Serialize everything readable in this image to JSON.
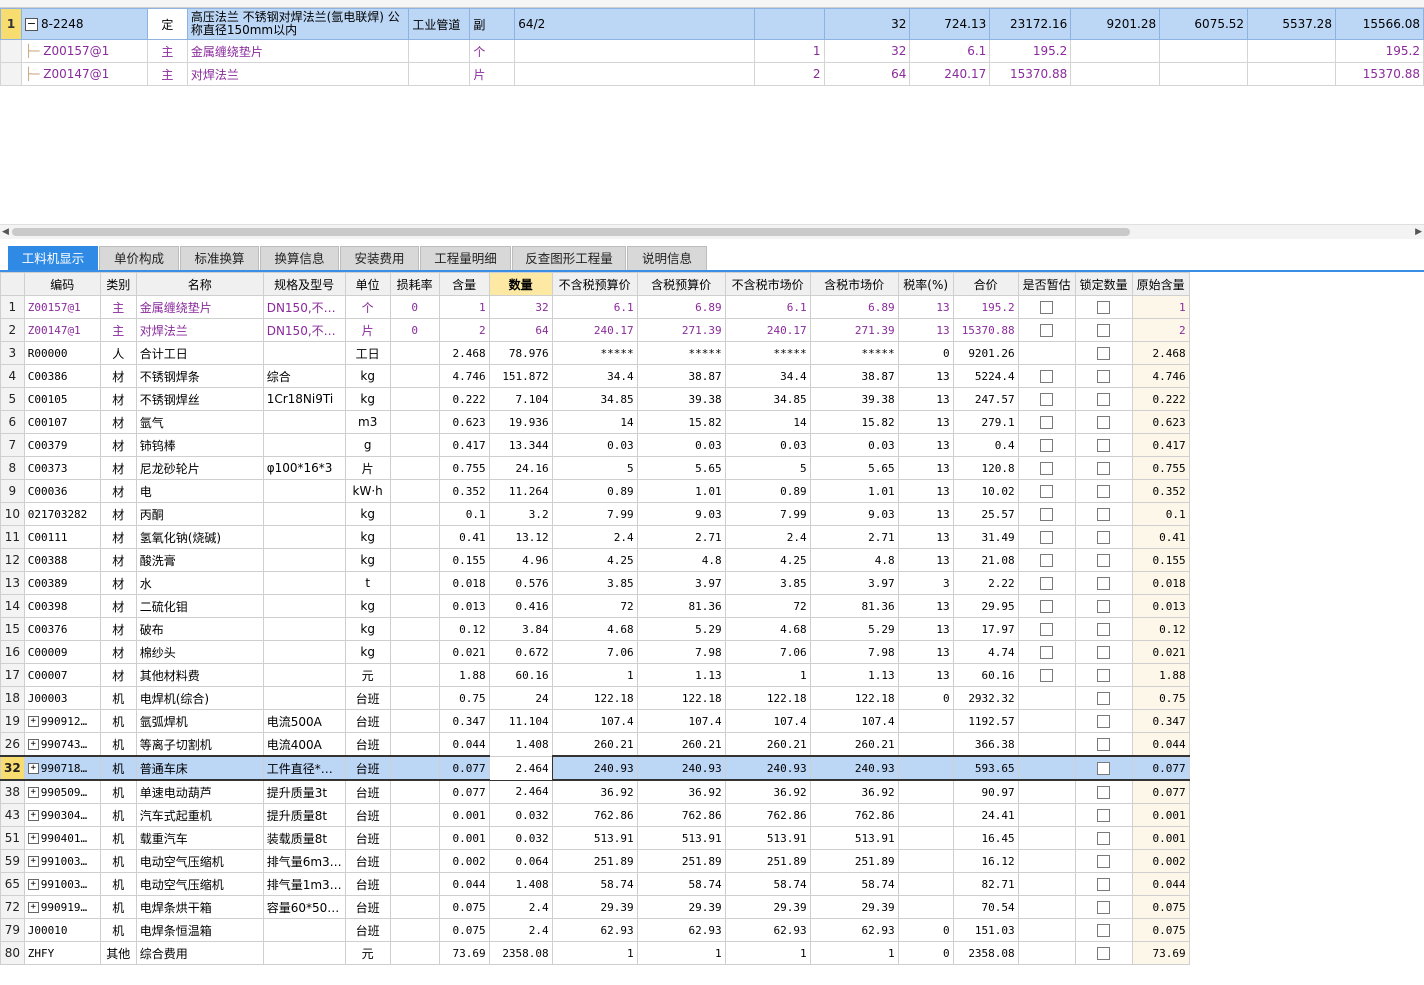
{
  "top_rows": [
    {
      "idx": "1",
      "code": "8-2248",
      "type": "定",
      "name": "高压法兰 不锈钢对焊法兰(氩电联焊) 公称直径150mm以内",
      "major": "工业管道",
      "unit": "副",
      "expr": "64/2",
      "coef": "",
      "qty": "32",
      "price": "724.13",
      "total": "23172.16",
      "c1": "9201.28",
      "c2": "6075.52",
      "c3": "5537.28",
      "c4": "15566.08"
    },
    {
      "idx": "",
      "code": "Z00157@1",
      "type": "主",
      "name": "金属缠绕垫片",
      "major": "",
      "unit": "个",
      "expr": "",
      "coef": "1",
      "qty": "32",
      "price": "6.1",
      "total": "195.2",
      "c1": "",
      "c2": "",
      "c3": "",
      "c4": "195.2"
    },
    {
      "idx": "",
      "code": "Z00147@1",
      "type": "主",
      "name": "对焊法兰",
      "major": "",
      "unit": "片",
      "expr": "",
      "coef": "2",
      "qty": "64",
      "price": "240.17",
      "total": "15370.88",
      "c1": "",
      "c2": "",
      "c3": "",
      "c4": "15370.88"
    }
  ],
  "tabs": [
    "工料机显示",
    "单价构成",
    "标准换算",
    "换算信息",
    "安装费用",
    "工程量明细",
    "反查图形工程量",
    "说明信息"
  ],
  "columns": [
    "编码",
    "类别",
    "名称",
    "规格及型号",
    "单位",
    "损耗率",
    "含量",
    "数量",
    "不含税预算价",
    "含税预算价",
    "不含税市场价",
    "含税市场价",
    "税率(%)",
    "合价",
    "是否暂估",
    "锁定数量",
    "原始含量"
  ],
  "rows": [
    {
      "idx": "1",
      "code": "Z00157@1",
      "cat": "主",
      "name": "金属缠绕垫片",
      "spec": "DN150,不…",
      "unit": "个",
      "loss": "0",
      "content": "1",
      "qty": "32",
      "p1": "6.1",
      "p2": "6.89",
      "p3": "6.1",
      "p4": "6.89",
      "tax": "13",
      "total": "195.2",
      "est": true,
      "orig": "1",
      "main": true
    },
    {
      "idx": "2",
      "code": "Z00147@1",
      "cat": "主",
      "name": "对焊法兰",
      "spec": "DN150,不…",
      "unit": "片",
      "loss": "0",
      "content": "2",
      "qty": "64",
      "p1": "240.17",
      "p2": "271.39",
      "p3": "240.17",
      "p4": "271.39",
      "tax": "13",
      "total": "15370.88",
      "est": true,
      "orig": "2",
      "main": true
    },
    {
      "idx": "3",
      "code": "R00000",
      "cat": "人",
      "name": "合计工日",
      "spec": "",
      "unit": "工日",
      "loss": "",
      "content": "2.468",
      "qty": "78.976",
      "p1": "*****",
      "p2": "*****",
      "p3": "*****",
      "p4": "*****",
      "tax": "0",
      "total": "9201.26",
      "est": false,
      "orig": "2.468"
    },
    {
      "idx": "4",
      "code": "C00386",
      "cat": "材",
      "name": "不锈钢焊条",
      "spec": "综合",
      "unit": "kg",
      "loss": "",
      "content": "4.746",
      "qty": "151.872",
      "p1": "34.4",
      "p2": "38.87",
      "p3": "34.4",
      "p4": "38.87",
      "tax": "13",
      "total": "5224.4",
      "est": true,
      "orig": "4.746"
    },
    {
      "idx": "5",
      "code": "C00105",
      "cat": "材",
      "name": "不锈钢焊丝",
      "spec": "1Cr18Ni9Ti",
      "unit": "kg",
      "loss": "",
      "content": "0.222",
      "qty": "7.104",
      "p1": "34.85",
      "p2": "39.38",
      "p3": "34.85",
      "p4": "39.38",
      "tax": "13",
      "total": "247.57",
      "est": true,
      "orig": "0.222"
    },
    {
      "idx": "6",
      "code": "C00107",
      "cat": "材",
      "name": "氩气",
      "spec": "",
      "unit": "m3",
      "loss": "",
      "content": "0.623",
      "qty": "19.936",
      "p1": "14",
      "p2": "15.82",
      "p3": "14",
      "p4": "15.82",
      "tax": "13",
      "total": "279.1",
      "est": true,
      "orig": "0.623"
    },
    {
      "idx": "7",
      "code": "C00379",
      "cat": "材",
      "name": "铈钨棒",
      "spec": "",
      "unit": "g",
      "loss": "",
      "content": "0.417",
      "qty": "13.344",
      "p1": "0.03",
      "p2": "0.03",
      "p3": "0.03",
      "p4": "0.03",
      "tax": "13",
      "total": "0.4",
      "est": true,
      "orig": "0.417"
    },
    {
      "idx": "8",
      "code": "C00373",
      "cat": "材",
      "name": "尼龙砂轮片",
      "spec": "φ100*16*3",
      "unit": "片",
      "loss": "",
      "content": "0.755",
      "qty": "24.16",
      "p1": "5",
      "p2": "5.65",
      "p3": "5",
      "p4": "5.65",
      "tax": "13",
      "total": "120.8",
      "est": true,
      "orig": "0.755"
    },
    {
      "idx": "9",
      "code": "C00036",
      "cat": "材",
      "name": "电",
      "spec": "",
      "unit": "kW·h",
      "loss": "",
      "content": "0.352",
      "qty": "11.264",
      "p1": "0.89",
      "p2": "1.01",
      "p3": "0.89",
      "p4": "1.01",
      "tax": "13",
      "total": "10.02",
      "est": true,
      "orig": "0.352"
    },
    {
      "idx": "10",
      "code": "021703282",
      "cat": "材",
      "name": "丙酮",
      "spec": "",
      "unit": "kg",
      "loss": "",
      "content": "0.1",
      "qty": "3.2",
      "p1": "7.99",
      "p2": "9.03",
      "p3": "7.99",
      "p4": "9.03",
      "tax": "13",
      "total": "25.57",
      "est": true,
      "orig": "0.1"
    },
    {
      "idx": "11",
      "code": "C00111",
      "cat": "材",
      "name": "氢氧化钠(烧碱)",
      "spec": "",
      "unit": "kg",
      "loss": "",
      "content": "0.41",
      "qty": "13.12",
      "p1": "2.4",
      "p2": "2.71",
      "p3": "2.4",
      "p4": "2.71",
      "tax": "13",
      "total": "31.49",
      "est": true,
      "orig": "0.41"
    },
    {
      "idx": "12",
      "code": "C00388",
      "cat": "材",
      "name": "酸洗膏",
      "spec": "",
      "unit": "kg",
      "loss": "",
      "content": "0.155",
      "qty": "4.96",
      "p1": "4.25",
      "p2": "4.8",
      "p3": "4.25",
      "p4": "4.8",
      "tax": "13",
      "total": "21.08",
      "est": true,
      "orig": "0.155"
    },
    {
      "idx": "13",
      "code": "C00389",
      "cat": "材",
      "name": "水",
      "spec": "",
      "unit": "t",
      "loss": "",
      "content": "0.018",
      "qty": "0.576",
      "p1": "3.85",
      "p2": "3.97",
      "p3": "3.85",
      "p4": "3.97",
      "tax": "3",
      "total": "2.22",
      "est": true,
      "orig": "0.018"
    },
    {
      "idx": "14",
      "code": "C00398",
      "cat": "材",
      "name": "二硫化钼",
      "spec": "",
      "unit": "kg",
      "loss": "",
      "content": "0.013",
      "qty": "0.416",
      "p1": "72",
      "p2": "81.36",
      "p3": "72",
      "p4": "81.36",
      "tax": "13",
      "total": "29.95",
      "est": true,
      "orig": "0.013"
    },
    {
      "idx": "15",
      "code": "C00376",
      "cat": "材",
      "name": "破布",
      "spec": "",
      "unit": "kg",
      "loss": "",
      "content": "0.12",
      "qty": "3.84",
      "p1": "4.68",
      "p2": "5.29",
      "p3": "4.68",
      "p4": "5.29",
      "tax": "13",
      "total": "17.97",
      "est": true,
      "orig": "0.12"
    },
    {
      "idx": "16",
      "code": "C00009",
      "cat": "材",
      "name": "棉纱头",
      "spec": "",
      "unit": "kg",
      "loss": "",
      "content": "0.021",
      "qty": "0.672",
      "p1": "7.06",
      "p2": "7.98",
      "p3": "7.06",
      "p4": "7.98",
      "tax": "13",
      "total": "4.74",
      "est": true,
      "orig": "0.021"
    },
    {
      "idx": "17",
      "code": "C00007",
      "cat": "材",
      "name": "其他材料费",
      "spec": "",
      "unit": "元",
      "loss": "",
      "content": "1.88",
      "qty": "60.16",
      "p1": "1",
      "p2": "1.13",
      "p3": "1",
      "p4": "1.13",
      "tax": "13",
      "total": "60.16",
      "est": true,
      "orig": "1.88"
    },
    {
      "idx": "18",
      "code": "J00003",
      "cat": "机",
      "name": "电焊机(综合)",
      "spec": "",
      "unit": "台班",
      "loss": "",
      "content": "0.75",
      "qty": "24",
      "p1": "122.18",
      "p2": "122.18",
      "p3": "122.18",
      "p4": "122.18",
      "tax": "0",
      "total": "2932.32",
      "est": false,
      "orig": "0.75"
    },
    {
      "idx": "19",
      "code": "990912…",
      "cat": "机",
      "name": "氩弧焊机",
      "spec": "电流500A",
      "unit": "台班",
      "loss": "",
      "content": "0.347",
      "qty": "11.104",
      "p1": "107.4",
      "p2": "107.4",
      "p3": "107.4",
      "p4": "107.4",
      "tax": "",
      "total": "1192.57",
      "est": false,
      "orig": "0.347",
      "expand": true
    },
    {
      "idx": "26",
      "code": "990743…",
      "cat": "机",
      "name": "等离子切割机",
      "spec": "电流400A",
      "unit": "台班",
      "loss": "",
      "content": "0.044",
      "qty": "1.408",
      "p1": "260.21",
      "p2": "260.21",
      "p3": "260.21",
      "p4": "260.21",
      "tax": "",
      "total": "366.38",
      "est": false,
      "orig": "0.044",
      "expand": true
    },
    {
      "idx": "32",
      "code": "990718…",
      "cat": "机",
      "name": "普通车床",
      "spec": "工件直径*…",
      "unit": "台班",
      "loss": "",
      "content": "0.077",
      "qty": "2.464",
      "p1": "240.93",
      "p2": "240.93",
      "p3": "240.93",
      "p4": "240.93",
      "tax": "",
      "total": "593.65",
      "est": false,
      "orig": "0.077",
      "expand": true,
      "selected": true
    },
    {
      "idx": "38",
      "code": "990509…",
      "cat": "机",
      "name": "单速电动葫芦",
      "spec": "提升质量3t",
      "unit": "台班",
      "loss": "",
      "content": "0.077",
      "qty": "2.464",
      "p1": "36.92",
      "p2": "36.92",
      "p3": "36.92",
      "p4": "36.92",
      "tax": "",
      "total": "90.97",
      "est": false,
      "orig": "0.077",
      "expand": true
    },
    {
      "idx": "43",
      "code": "990304…",
      "cat": "机",
      "name": "汽车式起重机",
      "spec": "提升质量8t",
      "unit": "台班",
      "loss": "",
      "content": "0.001",
      "qty": "0.032",
      "p1": "762.86",
      "p2": "762.86",
      "p3": "762.86",
      "p4": "762.86",
      "tax": "",
      "total": "24.41",
      "est": false,
      "orig": "0.001",
      "expand": true
    },
    {
      "idx": "51",
      "code": "990401…",
      "cat": "机",
      "name": "载重汽车",
      "spec": "装载质量8t",
      "unit": "台班",
      "loss": "",
      "content": "0.001",
      "qty": "0.032",
      "p1": "513.91",
      "p2": "513.91",
      "p3": "513.91",
      "p4": "513.91",
      "tax": "",
      "total": "16.45",
      "est": false,
      "orig": "0.001",
      "expand": true
    },
    {
      "idx": "59",
      "code": "991003…",
      "cat": "机",
      "name": "电动空气压缩机",
      "spec": "排气量6m3…",
      "unit": "台班",
      "loss": "",
      "content": "0.002",
      "qty": "0.064",
      "p1": "251.89",
      "p2": "251.89",
      "p3": "251.89",
      "p4": "251.89",
      "tax": "",
      "total": "16.12",
      "est": false,
      "orig": "0.002",
      "expand": true
    },
    {
      "idx": "65",
      "code": "991003…",
      "cat": "机",
      "name": "电动空气压缩机",
      "spec": "排气量1m3…",
      "unit": "台班",
      "loss": "",
      "content": "0.044",
      "qty": "1.408",
      "p1": "58.74",
      "p2": "58.74",
      "p3": "58.74",
      "p4": "58.74",
      "tax": "",
      "total": "82.71",
      "est": false,
      "orig": "0.044",
      "expand": true
    },
    {
      "idx": "72",
      "code": "990919…",
      "cat": "机",
      "name": "电焊条烘干箱",
      "spec": "容量60*50…",
      "unit": "台班",
      "loss": "",
      "content": "0.075",
      "qty": "2.4",
      "p1": "29.39",
      "p2": "29.39",
      "p3": "29.39",
      "p4": "29.39",
      "tax": "",
      "total": "70.54",
      "est": false,
      "orig": "0.075",
      "expand": true
    },
    {
      "idx": "79",
      "code": "J00010",
      "cat": "机",
      "name": "电焊条恒温箱",
      "spec": "",
      "unit": "台班",
      "loss": "",
      "content": "0.075",
      "qty": "2.4",
      "p1": "62.93",
      "p2": "62.93",
      "p3": "62.93",
      "p4": "62.93",
      "tax": "0",
      "total": "151.03",
      "est": false,
      "orig": "0.075"
    },
    {
      "idx": "80",
      "code": "ZHFY",
      "cat": "其他",
      "name": "综合费用",
      "spec": "",
      "unit": "元",
      "loss": "",
      "content": "73.69",
      "qty": "2358.08",
      "p1": "1",
      "p2": "1",
      "p3": "1",
      "p4": "1",
      "tax": "0",
      "total": "2358.08",
      "est": false,
      "orig": "73.69"
    }
  ]
}
